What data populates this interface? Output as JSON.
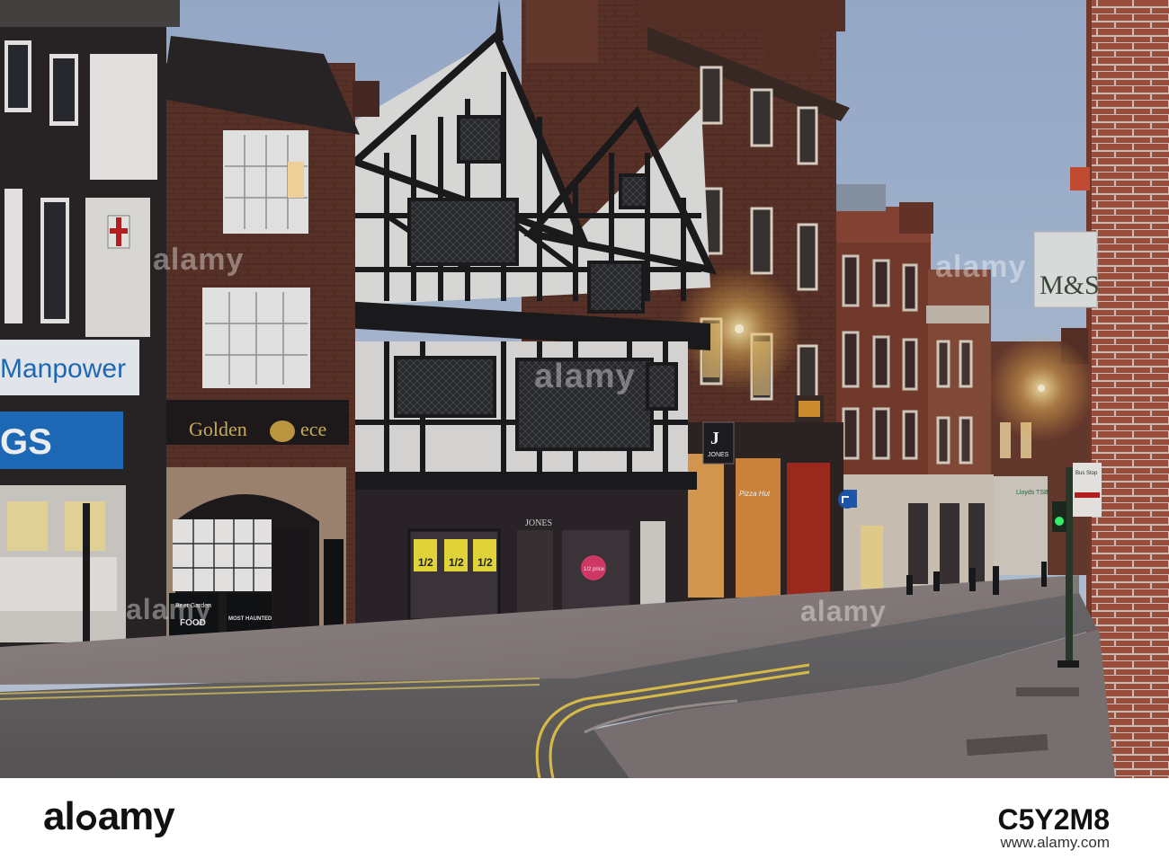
{
  "scene": {
    "signs": {
      "manpower": "Manpower",
      "shop_left": "GS",
      "pub_name_left": "Golden",
      "pub_name_right": "ece",
      "jones_shop": "JONES",
      "jones_hanging": "JONES",
      "ms_sign": "M&S",
      "pub_board_1": "Beer Garden",
      "pub_board_1_food": "FOOD",
      "pub_board_2": "MOST HAUNTED",
      "sale_half": "1/2",
      "sale_price": "1/2 price",
      "pizza": "Pizza Hut",
      "bus_stop": "Bus Stop"
    },
    "colors": {
      "sky": "#a9bcd8",
      "brick": "#6b3a2a",
      "timber_white": "#e8e6e2",
      "timber_black": "#1c1a1a",
      "road": "#7a7775",
      "pavement": "#8f8480",
      "lamp_glow": "#ffcf7a",
      "sale_yellow": "#f2e23a",
      "manpower_blue": "#1f6fc0",
      "pizza_red": "#b03020"
    }
  },
  "watermark": {
    "text": "alamy"
  },
  "footer": {
    "logo_text_left": "al",
    "logo_text_right": "amy",
    "image_id": "C5Y2M8",
    "url": "www.alamy.com"
  }
}
